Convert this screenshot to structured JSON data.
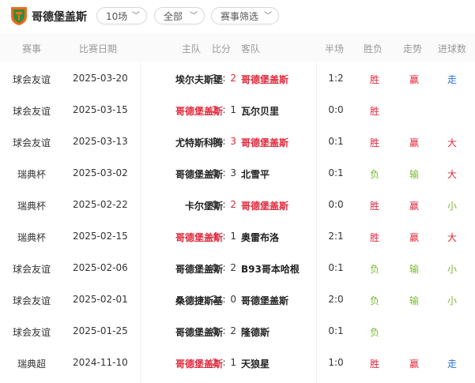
{
  "header": {
    "team_name": "哥德堡盖斯",
    "filter_count": "10场",
    "filter_scope": "全部",
    "filter_event": "赛事筛选"
  },
  "columns": {
    "event": "赛事",
    "date": "比赛日期",
    "home": "主队",
    "score": "比分",
    "away": "客队",
    "half": "半场",
    "result": "胜负",
    "trend": "走势",
    "goals": "进球数"
  },
  "colors": {
    "red": "#e0283b",
    "green": "#7cb82f",
    "blue": "#2a72d6",
    "logo_orange": "#f26a1b",
    "logo_green": "#2f8f3a"
  },
  "matches": [
    {
      "event": "球会友谊",
      "date": "2025-03-20",
      "home": "埃尔夫斯堡",
      "hs": "1",
      "as": "2",
      "away": "哥德堡盖斯",
      "half": "1:2",
      "result": "胜",
      "trend": "赢",
      "goals": "走",
      "hl": "away"
    },
    {
      "event": "球会友谊",
      "date": "2025-03-15",
      "home": "哥德堡盖斯",
      "hs": "2",
      "as": "1",
      "away": "瓦尔贝里",
      "half": "0:0",
      "result": "胜",
      "trend": "",
      "goals": "",
      "hl": "home"
    },
    {
      "event": "球会友谊",
      "date": "2025-03-13",
      "home": "尤特斯科腾",
      "hs": "0",
      "as": "3",
      "away": "哥德堡盖斯",
      "half": "0:1",
      "result": "胜",
      "trend": "赢",
      "goals": "大",
      "hl": "away"
    },
    {
      "event": "瑞典杯",
      "date": "2025-03-02",
      "home": "哥德堡盖斯",
      "hs": "0",
      "as": "3",
      "away": "北雪平",
      "half": "0:1",
      "result": "负",
      "trend": "输",
      "goals": "大",
      "hl": "none"
    },
    {
      "event": "瑞典杯",
      "date": "2025-02-22",
      "home": "卡尔堡斯",
      "hs": "0",
      "as": "2",
      "away": "哥德堡盖斯",
      "half": "0:0",
      "result": "胜",
      "trend": "赢",
      "goals": "小",
      "hl": "away"
    },
    {
      "event": "瑞典杯",
      "date": "2025-02-15",
      "home": "哥德堡盖斯",
      "hs": "4",
      "as": "1",
      "away": "奥雷布洛",
      "half": "2:1",
      "result": "胜",
      "trend": "赢",
      "goals": "大",
      "hl": "home"
    },
    {
      "event": "球会友谊",
      "date": "2025-02-06",
      "home": "哥德堡盖斯",
      "hs": "0",
      "as": "2",
      "away": "B93哥本哈根",
      "half": "0:1",
      "result": "负",
      "trend": "输",
      "goals": "小",
      "hl": "none"
    },
    {
      "event": "球会友谊",
      "date": "2025-02-01",
      "home": "桑德捷斯基",
      "hs": "2",
      "as": "0",
      "away": "哥德堡盖斯",
      "half": "2:0",
      "result": "负",
      "trend": "输",
      "goals": "小",
      "hl": "none"
    },
    {
      "event": "球会友谊",
      "date": "2025-01-25",
      "home": "哥德堡盖斯",
      "hs": "0",
      "as": "2",
      "away": "隆德斯",
      "half": "0:1",
      "result": "负",
      "trend": "",
      "goals": "",
      "hl": "none"
    },
    {
      "event": "瑞典超",
      "date": "2024-11-10",
      "home": "哥德堡盖斯",
      "hs": "2",
      "as": "1",
      "away": "天狼星",
      "half": "1:0",
      "result": "胜",
      "trend": "赢",
      "goals": "走",
      "hl": "home"
    }
  ]
}
